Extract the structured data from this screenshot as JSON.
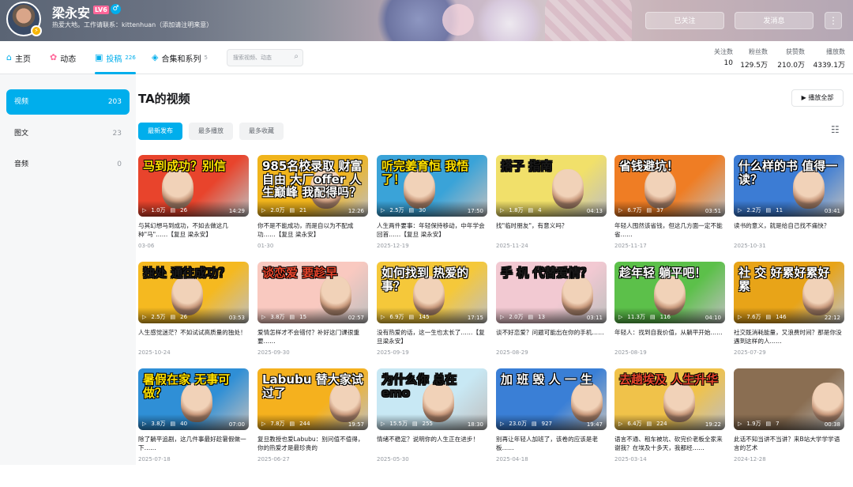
{
  "header": {
    "username": "梁永安",
    "level": "LV6",
    "gender_icon": "male-icon",
    "sign": "热爱大地。工作请联系：kittenhuan（添加请注明来意）",
    "follow_label": "已关注",
    "message_label": "发消息",
    "more_label": "⋮"
  },
  "nav": {
    "home": "主页",
    "dynamic": "动态",
    "posts": "投稿",
    "posts_count": "226",
    "collections": "合集和系列",
    "collections_count": "5",
    "search_placeholder": "搜索视频、动态"
  },
  "stats": [
    {
      "label": "关注数",
      "value": "10"
    },
    {
      "label": "粉丝数",
      "value": "129.5万"
    },
    {
      "label": "获赞数",
      "value": "210.0万"
    },
    {
      "label": "播放数",
      "value": "4339.1万"
    }
  ],
  "sidebar": [
    {
      "label": "视频",
      "count": "203"
    },
    {
      "label": "图文",
      "count": "23"
    },
    {
      "label": "音频",
      "count": "0"
    }
  ],
  "main": {
    "title": "TA的视频",
    "play_all": "▶ 播放全部",
    "tabs": [
      "最新发布",
      "最多播放",
      "最多收藏"
    ]
  },
  "videos": [
    {
      "thumb_text": "马到成功？别信",
      "views": "1.0万",
      "comments": "26",
      "duration": "14:29",
      "title": "与其幻想马到成功，不如去做这几种\"马\"……【复旦 梁永安】",
      "date": "03-06",
      "bg": "#e8442c",
      "fg": "#ffe100"
    },
    {
      "thumb_text": "985名校录取 财富自由 大厂offer 人生巅峰 我配得吗？",
      "views": "2.0万",
      "comments": "21",
      "duration": "12:26",
      "title": "你不是不能成功，而是自以为不配成功……【复旦 梁永安】",
      "date": "01-30",
      "bg": "#f0b41c",
      "fg": "#ffffff"
    },
    {
      "thumb_text": "听完姜育恒 我悟了！",
      "views": "2.5万",
      "comments": "30",
      "duration": "17:50",
      "title": "人生两件要事：年轻保持移动，中年学会回首……【复旦 梁永安】",
      "date": "2025-12-19",
      "bg": "#3aa3d8",
      "fg": "#ffe100"
    },
    {
      "thumb_text": "搭子 指南",
      "views": "1.8万",
      "comments": "4",
      "duration": "04:13",
      "title": "找\"临时朋友\"，有意义吗？",
      "date": "2025-11-24",
      "bg": "#f1e06a",
      "fg": "#1a1a1a"
    },
    {
      "thumb_text": "省钱避坑！",
      "views": "6.7万",
      "comments": "37",
      "duration": "03:51",
      "title": "年轻人囤然该省钱，但这几方面一定不能省……",
      "date": "2025-11-17",
      "bg": "#ef7d24",
      "fg": "#ffffff"
    },
    {
      "thumb_text": "什么样的书 值得一读？",
      "views": "2.2万",
      "comments": "11",
      "duration": "03:41",
      "title": "读书的意义，就是给自己找不痛快？",
      "date": "2025-10-31",
      "bg": "#3c7cd4",
      "fg": "#ffffff"
    },
    {
      "thumb_text": "独处 通往成功？",
      "views": "2.5万",
      "comments": "26",
      "duration": "03:53",
      "title": "人生感觉迷茫？不如试试高质量的独处！",
      "date": "2025-10-24",
      "bg": "#f5b920",
      "fg": "#1a1a1a"
    },
    {
      "thumb_text": "谈恋爱 要趁早",
      "views": "3.8万",
      "comments": "15",
      "duration": "02:57",
      "title": "爱情怎样才不会错付？补好这门课很重要……",
      "date": "2025-09-30",
      "bg": "#f9c9c0",
      "fg": "#e8442c"
    },
    {
      "thumb_text": "如何找到 热爱的事？",
      "views": "6.9万",
      "comments": "145",
      "duration": "17:15",
      "title": "没有热爱的话，这一生也太长了……【复旦梁永安】",
      "date": "2025-09-19",
      "bg": "#f5c83a",
      "fg": "#ffffff"
    },
    {
      "thumb_text": "手 机 代替爱情？",
      "views": "2.0万",
      "comments": "13",
      "duration": "03:11",
      "title": "谈不好恋爱？问题可能出在你的手机……",
      "date": "2025-08-29",
      "bg": "#f2c9d2",
      "fg": "#1a1a1a"
    },
    {
      "thumb_text": "趁年轻 躺平吧！",
      "views": "11.3万",
      "comments": "116",
      "duration": "04:10",
      "title": "年轻人：找到自我价值，从躺平开始……",
      "date": "2025-08-19",
      "bg": "#5cc04a",
      "fg": "#ffffff"
    },
    {
      "thumb_text": "社 交 好累好累好累",
      "views": "7.6万",
      "comments": "146",
      "duration": "22:12",
      "title": "社交既消耗能量，又浪费时间？那是你没遇到这样的人……",
      "date": "2025-07-29",
      "bg": "#e8a418",
      "fg": "#ffffff"
    },
    {
      "thumb_text": "暑假在家 无事可做？",
      "views": "3.8万",
      "comments": "40",
      "duration": "07:00",
      "title": "除了躺平追剧，这几件事最好趁暑假做一下……",
      "date": "2025-07-18",
      "bg": "#2f8fd6",
      "fg": "#ffe100"
    },
    {
      "thumb_text": "Labubu 替大家试过了",
      "views": "7.8万",
      "comments": "244",
      "duration": "19:57",
      "title": "复旦教授也爱Labubu：别问值不值得，你的热爱才是最珍贵的",
      "date": "2025-06-27",
      "bg": "#f5b11e",
      "fg": "#ffffff"
    },
    {
      "thumb_text": "为什么你 总在emo",
      "views": "15.5万",
      "comments": "255",
      "duration": "18:30",
      "title": "情绪不稳定？说明你的人生正在进步！",
      "date": "2025-05-30",
      "bg": "#c8e8f4",
      "fg": "#1a1a1a"
    },
    {
      "thumb_text": "加 班 毁 人 一 生",
      "views": "23.0万",
      "comments": "927",
      "duration": "19:47",
      "title": "别再让年轻人加班了，该卷的应该是老板……",
      "date": "2025-04-18",
      "bg": "#3a7fd6",
      "fg": "#ffffff"
    },
    {
      "thumb_text": "去趟埃及 人生升华",
      "views": "6.4万",
      "comments": "224",
      "duration": "19:22",
      "title": "语言不通、租车被坑、砍完价老板全家来谢我？在埃及十多天，我都经……",
      "date": "2025-03-14",
      "bg": "#f0c24a",
      "fg": "#e8442c"
    },
    {
      "thumb_text": "",
      "views": "1.9万",
      "comments": "7",
      "duration": "00:38",
      "title": "此话不知当讲不当讲？来B站大学学学语言的艺术",
      "date": "2024-12-28",
      "bg": "#8a6e52",
      "fg": "#ffffff"
    }
  ]
}
